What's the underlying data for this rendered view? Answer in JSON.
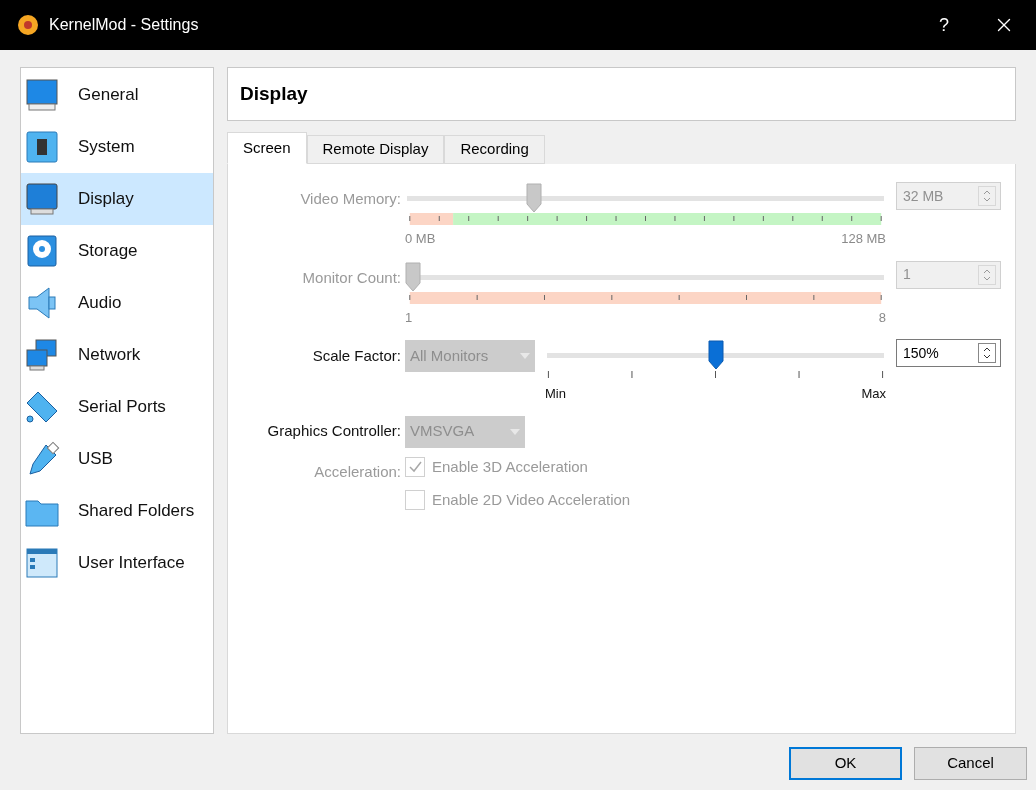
{
  "window": {
    "title": "KernelMod - Settings",
    "help": "?"
  },
  "sidebar": {
    "items": [
      {
        "label": "General",
        "selected": false
      },
      {
        "label": "System",
        "selected": false
      },
      {
        "label": "Display",
        "selected": true
      },
      {
        "label": "Storage",
        "selected": false
      },
      {
        "label": "Audio",
        "selected": false
      },
      {
        "label": "Network",
        "selected": false
      },
      {
        "label": "Serial Ports",
        "selected": false
      },
      {
        "label": "USB",
        "selected": false
      },
      {
        "label": "Shared Folders",
        "selected": false
      },
      {
        "label": "User Interface",
        "selected": false
      }
    ]
  },
  "page_title": "Display",
  "tabs": [
    {
      "label": "Screen",
      "selected": true
    },
    {
      "label": "Remote Display",
      "selected": false
    },
    {
      "label": "Recording",
      "selected": false
    }
  ],
  "sliders": [
    {
      "kind": "memory",
      "label": "Video Memory:",
      "disabled": true,
      "level": 0.26,
      "min_label": "0 MB",
      "max_label": "128 MB",
      "value": "32 MB"
    },
    {
      "kind": "count",
      "label": "Monitor Count:",
      "disabled": true,
      "level": 0,
      "min_label": "1",
      "max_label": "8",
      "value": "1"
    },
    {
      "kind": "scale",
      "label": "Scale Factor:",
      "disabled": false,
      "dropdown": {
        "value": "All Monitors",
        "disabled": true
      },
      "level": 0.5,
      "min_label": "Min",
      "max_label": "Max",
      "value": "150%"
    }
  ],
  "graphics_controller": {
    "label": "Graphics Controller:",
    "value": "VMSVGA",
    "disabled": true
  },
  "acceleration": {
    "label": "Acceleration:",
    "disabled": true,
    "options": [
      {
        "label": "Enable 3D Acceleration",
        "checked": true
      },
      {
        "label": "Enable 2D Video Acceleration",
        "checked": false
      }
    ]
  },
  "buttons": [
    {
      "label": "OK",
      "default": true
    },
    {
      "label": "Cancel",
      "default": false
    }
  ]
}
